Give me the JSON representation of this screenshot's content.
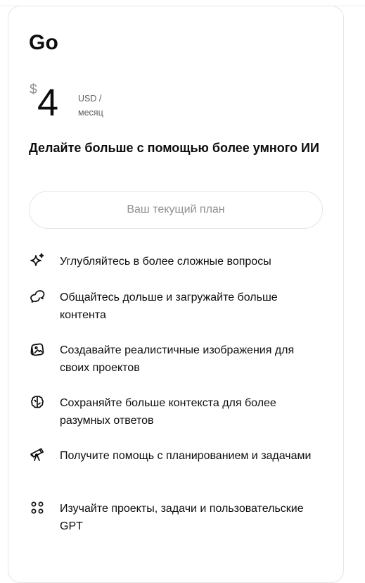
{
  "plan": {
    "name": "Go",
    "currency_symbol": "$",
    "price": "4",
    "unit_line1": "USD /",
    "unit_line2": "месяц",
    "tagline": "Делайте больше с помощью более умного ИИ",
    "current_plan_button": "Ваш текущий план"
  },
  "features": [
    {
      "icon": "sparkle-icon",
      "text": "Углубляйтесь в более сложные вопросы"
    },
    {
      "icon": "chat-bubbles-icon",
      "text": "Общайтесь дольше и загружайте больше контента"
    },
    {
      "icon": "image-gallery-icon",
      "text": "Создавайте реалистичные изображения для своих проектов"
    },
    {
      "icon": "brain-icon",
      "text": "Сохраняйте больше контекста для более разумных ответов"
    },
    {
      "icon": "telescope-icon",
      "text": "Получите помощь с планированием и задачами"
    },
    {
      "icon": "apps-grid-icon",
      "text": "Изучайте проекты, задачи и пользовательские GPT"
    }
  ]
}
